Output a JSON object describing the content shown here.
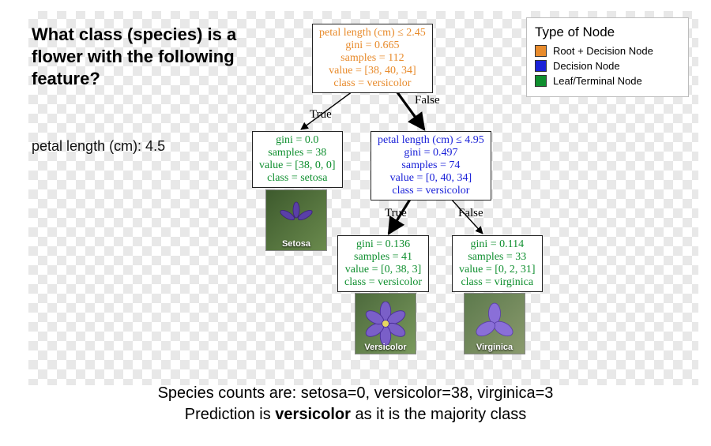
{
  "question": "What class (species) is a flower with the following feature?",
  "feature_text": "petal length (cm): 4.5",
  "legend": {
    "title": "Type of Node",
    "items": [
      {
        "label": "Root + Decision Node",
        "color": "#e88b2c"
      },
      {
        "label": "Decision Node",
        "color": "#1a21d8"
      },
      {
        "label": "Leaf/Terminal Node",
        "color": "#0f8f2f"
      }
    ]
  },
  "nodes": {
    "root": {
      "color": "#e88b2c",
      "l1": "petal length (cm) ≤ 2.45",
      "l2": "gini = 0.665",
      "l3": "samples = 112",
      "l4": "value = [38, 40, 34]",
      "l5": "class = versicolor"
    },
    "leaf_setosa": {
      "color": "#0f8f2f",
      "l1": "gini = 0.0",
      "l2": "samples = 38",
      "l3": "value = [38, 0, 0]",
      "l4": "class = setosa"
    },
    "decision": {
      "color": "#1a21d8",
      "l1": "petal length (cm) ≤ 4.95",
      "l2": "gini = 0.497",
      "l3": "samples = 74",
      "l4": "value = [0, 40, 34]",
      "l5": "class = versicolor"
    },
    "leaf_versicolor": {
      "color": "#0f8f2f",
      "l1": "gini = 0.136",
      "l2": "samples = 41",
      "l3": "value = [0, 38, 3]",
      "l4": "class = versicolor"
    },
    "leaf_virginica": {
      "color": "#0f8f2f",
      "l1": "gini = 0.114",
      "l2": "samples = 33",
      "l3": "value = [0, 2, 31]",
      "l4": "class = virginica"
    }
  },
  "edge_labels": {
    "true": "True",
    "false": "False"
  },
  "photos": {
    "setosa": "Setosa",
    "versicolor": "Versicolor",
    "virginica": "Virginica"
  },
  "caption": {
    "line1": "Species counts are: setosa=0, versicolor=38, virginica=3",
    "line2a": "Prediction is ",
    "line2b": "versicolor",
    "line2c": " as it is the majority class"
  }
}
